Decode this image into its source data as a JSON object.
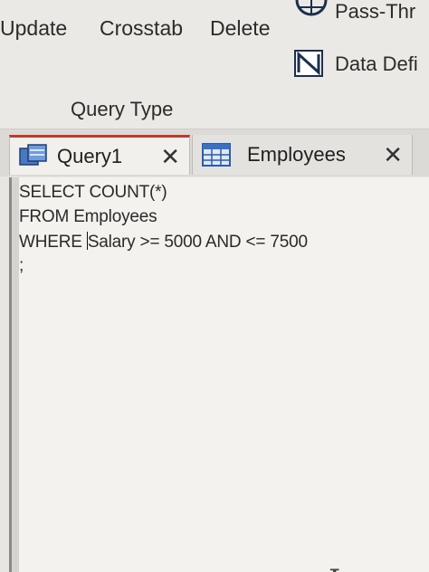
{
  "ribbon": {
    "buttons": {
      "update": "Update",
      "crosstab": "Crosstab",
      "delete": "Delete",
      "pass_through": "Pass-Thr",
      "data_definition": "Data Defi"
    },
    "group_label": "Query Type"
  },
  "tabs": [
    {
      "label": "Query1",
      "active": true,
      "icon": "query-icon"
    },
    {
      "label": "Employees",
      "active": false,
      "icon": "table-icon"
    }
  ],
  "editor": {
    "lines": [
      "SELECT COUNT(*)",
      "FROM Employees",
      "WHERE ",
      "Salary >= 5000 AND <= 7500",
      ";"
    ]
  },
  "colors": {
    "active_tab_accent": "#c0392b",
    "editor_background": "#f3f2ee"
  }
}
